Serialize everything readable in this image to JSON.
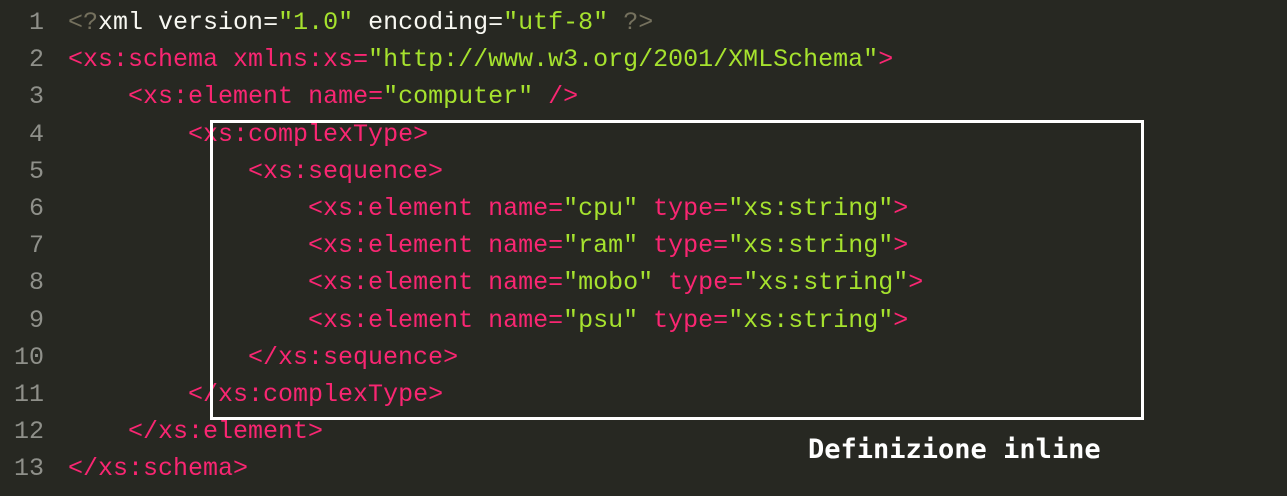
{
  "editor": {
    "lines": [
      {
        "num": "1",
        "tokens": [
          {
            "t": "<?",
            "c": "pi"
          },
          {
            "t": "xml",
            "c": "txt"
          },
          {
            "t": " ",
            "c": "txt"
          },
          {
            "t": "version",
            "c": "txt"
          },
          {
            "t": "=",
            "c": "txt"
          },
          {
            "t": "\"1.0\"",
            "c": "str"
          },
          {
            "t": " ",
            "c": "txt"
          },
          {
            "t": "encoding",
            "c": "txt"
          },
          {
            "t": "=",
            "c": "txt"
          },
          {
            "t": "\"utf-8\"",
            "c": "str"
          },
          {
            "t": " ",
            "c": "txt"
          },
          {
            "t": "?>",
            "c": "pi"
          }
        ]
      },
      {
        "num": "2",
        "tokens": [
          {
            "t": "<xs:schema",
            "c": "tag"
          },
          {
            "t": " ",
            "c": "txt"
          },
          {
            "t": "xmlns:xs",
            "c": "attr"
          },
          {
            "t": "=",
            "c": "attr"
          },
          {
            "t": "\"http://www.w3.org/2001/XMLSchema\"",
            "c": "str"
          },
          {
            "t": ">",
            "c": "tag"
          }
        ]
      },
      {
        "num": "3",
        "tokens": [
          {
            "t": "    ",
            "c": "txt"
          },
          {
            "t": "<xs:element",
            "c": "tag"
          },
          {
            "t": " ",
            "c": "txt"
          },
          {
            "t": "name",
            "c": "attr"
          },
          {
            "t": "=",
            "c": "attr"
          },
          {
            "t": "\"computer\"",
            "c": "str"
          },
          {
            "t": " ",
            "c": "txt"
          },
          {
            "t": "/>",
            "c": "tag"
          }
        ]
      },
      {
        "num": "4",
        "tokens": [
          {
            "t": "        ",
            "c": "txt"
          },
          {
            "t": "<xs:complexType>",
            "c": "tag"
          }
        ]
      },
      {
        "num": "5",
        "tokens": [
          {
            "t": "            ",
            "c": "txt"
          },
          {
            "t": "<xs:sequence>",
            "c": "tag"
          }
        ]
      },
      {
        "num": "6",
        "tokens": [
          {
            "t": "                ",
            "c": "txt"
          },
          {
            "t": "<xs:element",
            "c": "tag"
          },
          {
            "t": " ",
            "c": "txt"
          },
          {
            "t": "name",
            "c": "attr"
          },
          {
            "t": "=",
            "c": "attr"
          },
          {
            "t": "\"cpu\"",
            "c": "str"
          },
          {
            "t": " ",
            "c": "txt"
          },
          {
            "t": "type",
            "c": "attr"
          },
          {
            "t": "=",
            "c": "attr"
          },
          {
            "t": "\"xs:string\"",
            "c": "str"
          },
          {
            "t": ">",
            "c": "tag"
          }
        ]
      },
      {
        "num": "7",
        "tokens": [
          {
            "t": "                ",
            "c": "txt"
          },
          {
            "t": "<xs:element",
            "c": "tag"
          },
          {
            "t": " ",
            "c": "txt"
          },
          {
            "t": "name",
            "c": "attr"
          },
          {
            "t": "=",
            "c": "attr"
          },
          {
            "t": "\"ram\"",
            "c": "str"
          },
          {
            "t": " ",
            "c": "txt"
          },
          {
            "t": "type",
            "c": "attr"
          },
          {
            "t": "=",
            "c": "attr"
          },
          {
            "t": "\"xs:string\"",
            "c": "str"
          },
          {
            "t": ">",
            "c": "tag"
          }
        ]
      },
      {
        "num": "8",
        "tokens": [
          {
            "t": "                ",
            "c": "txt"
          },
          {
            "t": "<xs:element",
            "c": "tag"
          },
          {
            "t": " ",
            "c": "txt"
          },
          {
            "t": "name",
            "c": "attr"
          },
          {
            "t": "=",
            "c": "attr"
          },
          {
            "t": "\"mobo\"",
            "c": "str"
          },
          {
            "t": " ",
            "c": "txt"
          },
          {
            "t": "type",
            "c": "attr"
          },
          {
            "t": "=",
            "c": "attr"
          },
          {
            "t": "\"xs:string\"",
            "c": "str"
          },
          {
            "t": ">",
            "c": "tag"
          }
        ]
      },
      {
        "num": "9",
        "tokens": [
          {
            "t": "                ",
            "c": "txt"
          },
          {
            "t": "<xs:element",
            "c": "tag"
          },
          {
            "t": " ",
            "c": "txt"
          },
          {
            "t": "name",
            "c": "attr"
          },
          {
            "t": "=",
            "c": "attr"
          },
          {
            "t": "\"psu\"",
            "c": "str"
          },
          {
            "t": " ",
            "c": "txt"
          },
          {
            "t": "type",
            "c": "attr"
          },
          {
            "t": "=",
            "c": "attr"
          },
          {
            "t": "\"xs:string\"",
            "c": "str"
          },
          {
            "t": ">",
            "c": "tag"
          }
        ]
      },
      {
        "num": "10",
        "tokens": [
          {
            "t": "            ",
            "c": "txt"
          },
          {
            "t": "</xs:sequence>",
            "c": "tag"
          }
        ]
      },
      {
        "num": "11",
        "tokens": [
          {
            "t": "        ",
            "c": "txt"
          },
          {
            "t": "</xs:complexType>",
            "c": "tag"
          }
        ]
      },
      {
        "num": "12",
        "tokens": [
          {
            "t": "    ",
            "c": "txt"
          },
          {
            "t": "</xs:element>",
            "c": "tag"
          }
        ]
      },
      {
        "num": "13",
        "tokens": [
          {
            "t": "</xs:schema>",
            "c": "tag"
          }
        ]
      }
    ]
  },
  "annotation": {
    "caption": "Definizione inline"
  },
  "colors": {
    "background": "#272822",
    "tag": "#f92672",
    "string": "#a6e22e",
    "text": "#f8f8f2",
    "gutter": "#8f908a",
    "box": "#ffffff"
  }
}
